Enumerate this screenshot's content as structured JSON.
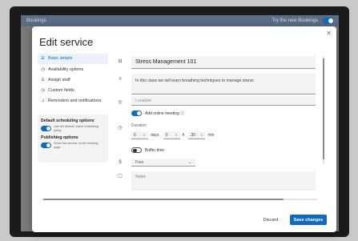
{
  "app": {
    "title": "Bookings",
    "try_new": "Try the new Bookings",
    "accent": "#0f6cbd"
  },
  "dialog": {
    "title": "Edit service",
    "close_icon": "close-icon"
  },
  "nav": {
    "items": [
      {
        "label": "Basic details",
        "icon": "list-icon",
        "active": true
      },
      {
        "label": "Availability options",
        "icon": "clock-icon"
      },
      {
        "label": "Assign staff",
        "icon": "person-icon"
      },
      {
        "label": "Custom fields",
        "icon": "clock-icon"
      },
      {
        "label": "Reminders and notifications",
        "icon": "bell-icon"
      }
    ]
  },
  "options": {
    "scheduling_heading": "Default scheduling options",
    "scheduling_text": "Use the default online scheduling policy",
    "publishing_heading": "Publishing options",
    "publishing_text": "Show this service on the booking page"
  },
  "form": {
    "name": "Stress Management 101",
    "description": "In this class we will learn breathing techniques to manage stress",
    "location_placeholder": "Location",
    "online_meeting_label": "Add online meeting ⓘ",
    "duration_label": "Duration",
    "duration_days": "0",
    "duration_hours": "0",
    "duration_minutes": "30",
    "days_unit": "days",
    "hours_unit": "h",
    "minutes_unit": "min",
    "buffer_label": "Buffer time",
    "price_value": "Free",
    "notes_placeholder": "Notes"
  },
  "footer": {
    "discard_label": "Discard",
    "save_label": "Save changes"
  }
}
